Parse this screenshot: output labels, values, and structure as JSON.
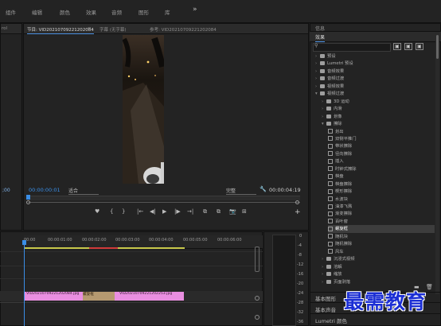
{
  "menu": [
    "组件",
    "编辑",
    "颜色",
    "效果",
    "音频",
    "图形",
    "库"
  ],
  "menu_more": "»",
  "source_panel": {
    "tabs": [
      "节目: VID20210709221202084",
      "≡",
      "字幕 (无字幕)",
      "参考: VID20210709221202084"
    ],
    "left_tab": "rol",
    "left_timecode": ";00"
  },
  "program": {
    "timecode": "00:00:00:01",
    "fit": "适合",
    "quality": "完整",
    "duration": "00:00:04:19",
    "buttons": [
      "♥",
      "{",
      "}",
      "|←",
      "◀|",
      "▶",
      "|▶",
      "→|",
      "⧉",
      "⧉",
      "📷",
      "⊞"
    ]
  },
  "timeline": {
    "ruler": [
      "00:00",
      "00:00:01:00",
      "00:00:02:00",
      "00:00:03:00",
      "00:00:04:00",
      "00:00:05:00",
      "00:00:06:00"
    ],
    "clip1": "VID20210709221202084.jpg",
    "transition": "螺旋框",
    "clip2": "VID20210709221202253.jpg",
    "meter_labels": [
      "0",
      "-4",
      "-8",
      "-12",
      "-16",
      "-20",
      "-24",
      "-28",
      "-32",
      "-36"
    ]
  },
  "effects_panel": {
    "header": "信息",
    "tab": "效果",
    "search_placeholder": "",
    "rows": [
      {
        "type": "folder",
        "indent": 0,
        "label": "预设"
      },
      {
        "type": "folder",
        "indent": 0,
        "label": "Lumetri 预设"
      },
      {
        "type": "folder",
        "indent": 0,
        "label": "音频效果"
      },
      {
        "type": "folder",
        "indent": 0,
        "label": "音频过渡"
      },
      {
        "type": "folder",
        "indent": 0,
        "label": "视频效果"
      },
      {
        "type": "folder",
        "indent": 0,
        "label": "视频过渡",
        "open": true
      },
      {
        "type": "folder",
        "indent": 1,
        "label": "3D 运动"
      },
      {
        "type": "folder",
        "indent": 1,
        "label": "内滑"
      },
      {
        "type": "folder",
        "indent": 1,
        "label": "划像"
      },
      {
        "type": "folder",
        "indent": 1,
        "label": "擦除",
        "open": true
      },
      {
        "type": "fx",
        "indent": 2,
        "label": "划出"
      },
      {
        "type": "fx",
        "indent": 2,
        "label": "双侧平推门"
      },
      {
        "type": "fx",
        "indent": 2,
        "label": "带状擦除"
      },
      {
        "type": "fx",
        "indent": 2,
        "label": "径向擦除"
      },
      {
        "type": "fx",
        "indent": 2,
        "label": "插入"
      },
      {
        "type": "fx",
        "indent": 2,
        "label": "时钟式擦除"
      },
      {
        "type": "fx",
        "indent": 2,
        "label": "棋盘"
      },
      {
        "type": "fx",
        "indent": 2,
        "label": "棋盘擦除"
      },
      {
        "type": "fx",
        "indent": 2,
        "label": "楔形擦除"
      },
      {
        "type": "fx",
        "indent": 2,
        "label": "水波块"
      },
      {
        "type": "fx",
        "indent": 2,
        "label": "油漆飞溅"
      },
      {
        "type": "fx",
        "indent": 2,
        "label": "渐变擦除"
      },
      {
        "type": "fx",
        "indent": 2,
        "label": "百叶窗"
      },
      {
        "type": "fx",
        "indent": 2,
        "label": "螺旋框",
        "selected": true
      },
      {
        "type": "fx",
        "indent": 2,
        "label": "随机块"
      },
      {
        "type": "fx",
        "indent": 2,
        "label": "随机擦除"
      },
      {
        "type": "fx",
        "indent": 2,
        "label": "风车"
      },
      {
        "type": "folder",
        "indent": 1,
        "label": "沉浸式视频"
      },
      {
        "type": "folder",
        "indent": 1,
        "label": "溶解"
      },
      {
        "type": "folder",
        "indent": 1,
        "label": "缩放"
      },
      {
        "type": "folder",
        "indent": 1,
        "label": "页面剥落"
      }
    ],
    "bottom_tabs": [
      "基本图形",
      "基本声音",
      "Lumetri 颜色"
    ]
  },
  "watermark": "最需教育",
  "colors": {
    "accent": "#3a8ee6",
    "clip": "#e98ee0",
    "watermark": "#1c2fd4"
  }
}
